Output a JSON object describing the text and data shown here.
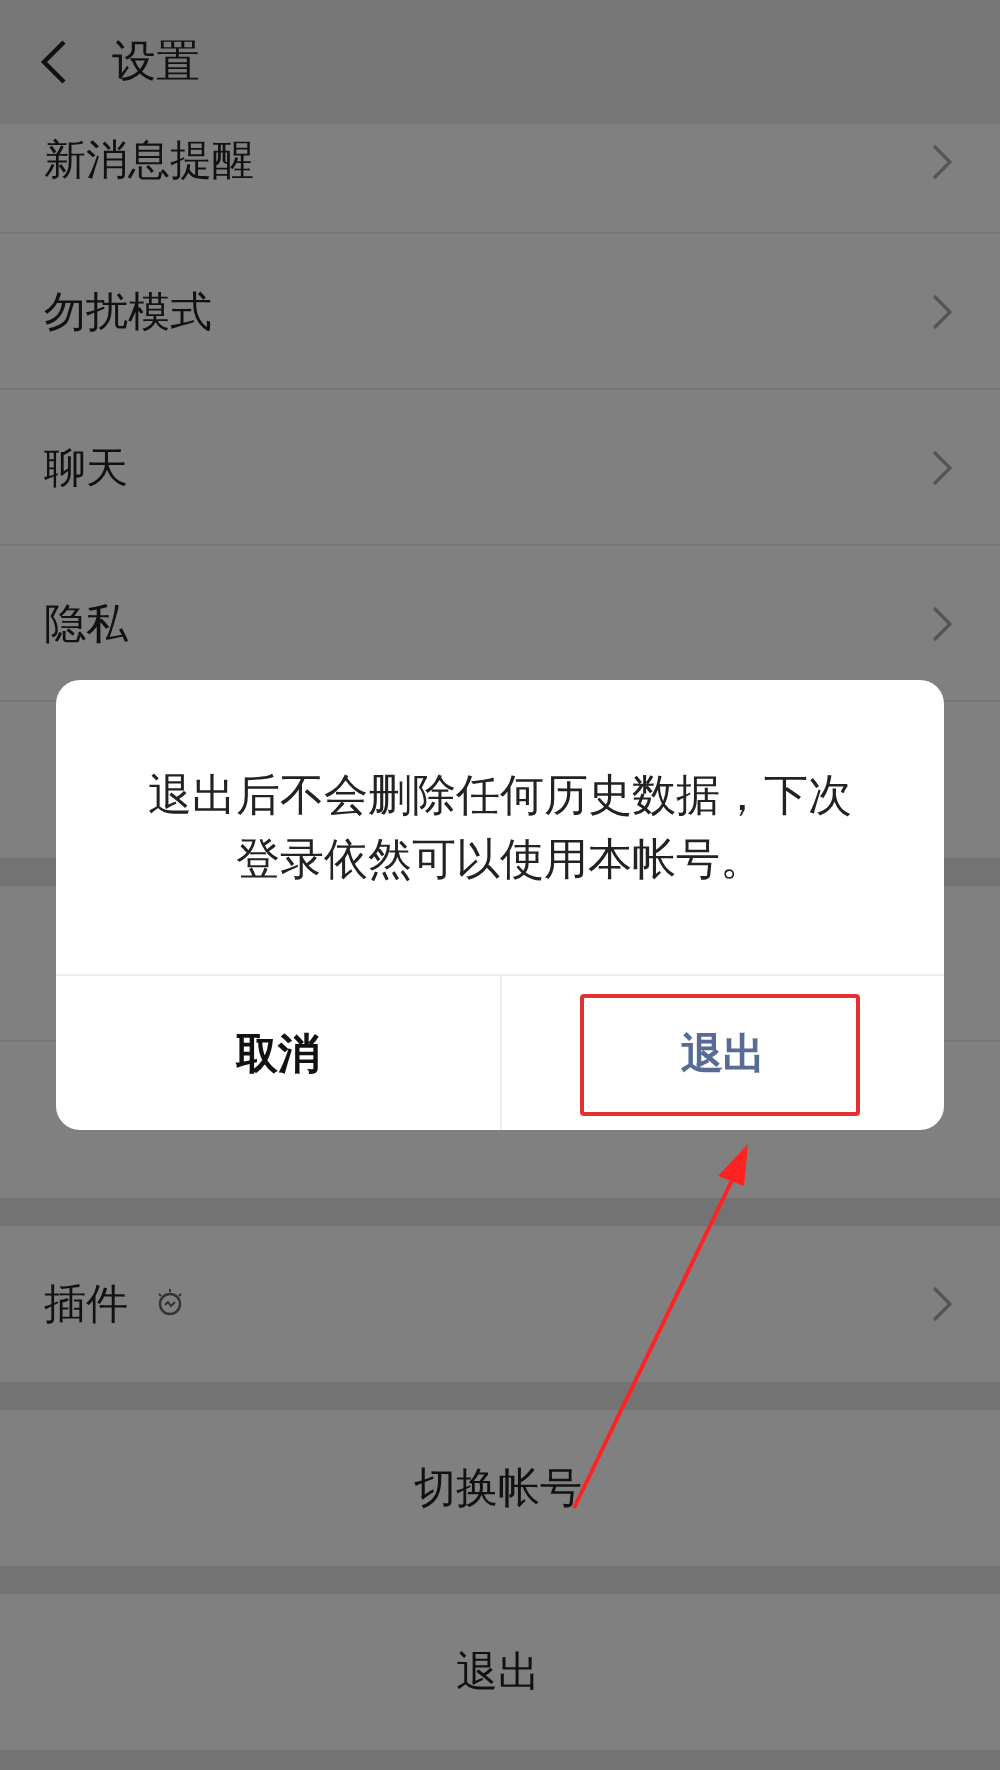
{
  "header": {
    "title": "设置"
  },
  "groups": [
    {
      "items": [
        {
          "kind": "nav",
          "label": "新消息提醒",
          "cut": true
        },
        {
          "kind": "nav",
          "label": "勿扰模式"
        },
        {
          "kind": "nav",
          "label": "聊天"
        },
        {
          "kind": "nav",
          "label": "隐私"
        },
        {
          "kind": "covered"
        }
      ]
    },
    {
      "items": [
        {
          "kind": "covered"
        },
        {
          "kind": "covered"
        }
      ]
    },
    {
      "items": [
        {
          "kind": "nav-icon",
          "label": "插件"
        }
      ]
    },
    {
      "items": [
        {
          "kind": "action",
          "label": "切换帐号"
        }
      ]
    },
    {
      "items": [
        {
          "kind": "action",
          "label": "退出"
        }
      ]
    }
  ],
  "dialog": {
    "message": "退出后不会删除任何历史数据，下次登录依然可以使用本帐号。",
    "buttons": [
      {
        "kind": "cancel",
        "label": "取消",
        "highlighted": false
      },
      {
        "kind": "confirm",
        "label": "退出",
        "highlighted": true
      }
    ]
  },
  "annotation_arrow": true
}
